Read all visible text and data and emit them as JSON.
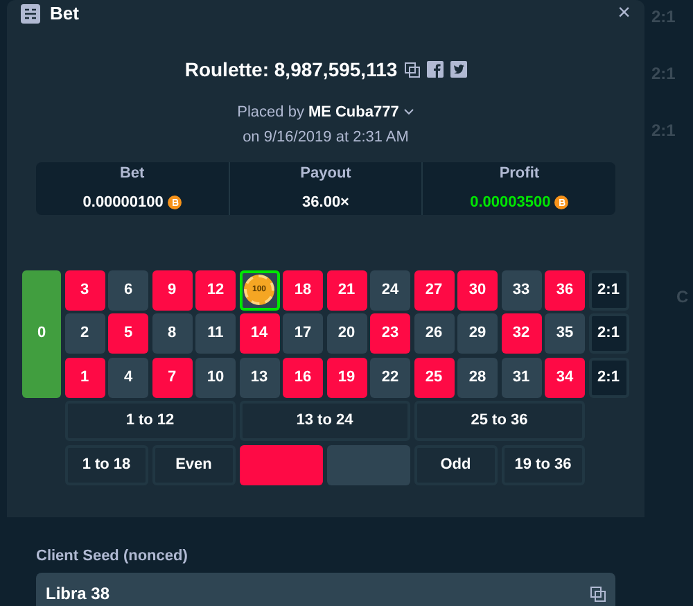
{
  "background": {
    "texts": [
      "2:1",
      "2:1",
      "2:1",
      "C"
    ]
  },
  "modal": {
    "title": "Bet",
    "close": "×"
  },
  "bet_title": "Roulette: 8,987,595,113",
  "placed_by": {
    "prefix": "Placed by",
    "rank": "ME",
    "user": "Cuba777",
    "date": "on 9/16/2019 at 2:31 AM"
  },
  "stats": [
    {
      "label": "Bet",
      "value": "0.00000100",
      "coin": true,
      "positive": false
    },
    {
      "label": "Payout",
      "value": "36.00×",
      "coin": false,
      "positive": false
    },
    {
      "label": "Profit",
      "value": "0.00003500",
      "coin": true,
      "positive": true
    }
  ],
  "zero": {
    "label": "0",
    "color": "#419e3f"
  },
  "rows": [
    {
      "cells": [
        {
          "n": "3",
          "color": "#fe0a45"
        },
        {
          "n": "6",
          "color": "#2f4553"
        },
        {
          "n": "9",
          "color": "#fe0a45"
        },
        {
          "n": "12",
          "color": "#fe0a45"
        },
        {
          "color": "#2f4553",
          "chip": "100",
          "winning": true
        },
        {
          "n": "18",
          "color": "#fe0a45"
        },
        {
          "n": "21",
          "color": "#fe0a45"
        },
        {
          "n": "24",
          "color": "#2f4553"
        },
        {
          "n": "27",
          "color": "#fe0a45"
        },
        {
          "n": "30",
          "color": "#fe0a45"
        },
        {
          "n": "33",
          "color": "#2f4553"
        },
        {
          "n": "36",
          "color": "#fe0a45"
        }
      ],
      "column_bet": "2:1"
    },
    {
      "cells": [
        {
          "n": "2",
          "color": "#2f4553"
        },
        {
          "n": "5",
          "color": "#fe0a45"
        },
        {
          "n": "8",
          "color": "#2f4553"
        },
        {
          "n": "11",
          "color": "#2f4553"
        },
        {
          "n": "14",
          "color": "#fe0a45"
        },
        {
          "n": "17",
          "color": "#2f4553"
        },
        {
          "n": "20",
          "color": "#2f4553"
        },
        {
          "n": "23",
          "color": "#fe0a45"
        },
        {
          "n": "26",
          "color": "#2f4553"
        },
        {
          "n": "29",
          "color": "#2f4553"
        },
        {
          "n": "32",
          "color": "#fe0a45"
        },
        {
          "n": "35",
          "color": "#2f4553"
        }
      ],
      "column_bet": "2:1"
    },
    {
      "cells": [
        {
          "n": "1",
          "color": "#fe0a45"
        },
        {
          "n": "4",
          "color": "#2f4553"
        },
        {
          "n": "7",
          "color": "#fe0a45"
        },
        {
          "n": "10",
          "color": "#2f4553"
        },
        {
          "n": "13",
          "color": "#2f4553"
        },
        {
          "n": "16",
          "color": "#fe0a45"
        },
        {
          "n": "19",
          "color": "#fe0a45"
        },
        {
          "n": "22",
          "color": "#2f4553"
        },
        {
          "n": "25",
          "color": "#fe0a45"
        },
        {
          "n": "28",
          "color": "#2f4553"
        },
        {
          "n": "31",
          "color": "#2f4553"
        },
        {
          "n": "34",
          "color": "#fe0a45"
        }
      ],
      "column_bet": "2:1"
    }
  ],
  "dozens": [
    "1 to 12",
    "13 to 24",
    "25 to 36"
  ],
  "outside": [
    {
      "kind": "text",
      "label": "1 to 18"
    },
    {
      "kind": "text",
      "label": "Even"
    },
    {
      "kind": "swatch",
      "color": "#fe0a45"
    },
    {
      "kind": "swatch",
      "color": "#2f4553"
    },
    {
      "kind": "text",
      "label": "Odd"
    },
    {
      "kind": "text",
      "label": "19 to 36"
    }
  ],
  "client_seed": {
    "label": "Client Seed (nonced)",
    "value": "Libra 38"
  }
}
